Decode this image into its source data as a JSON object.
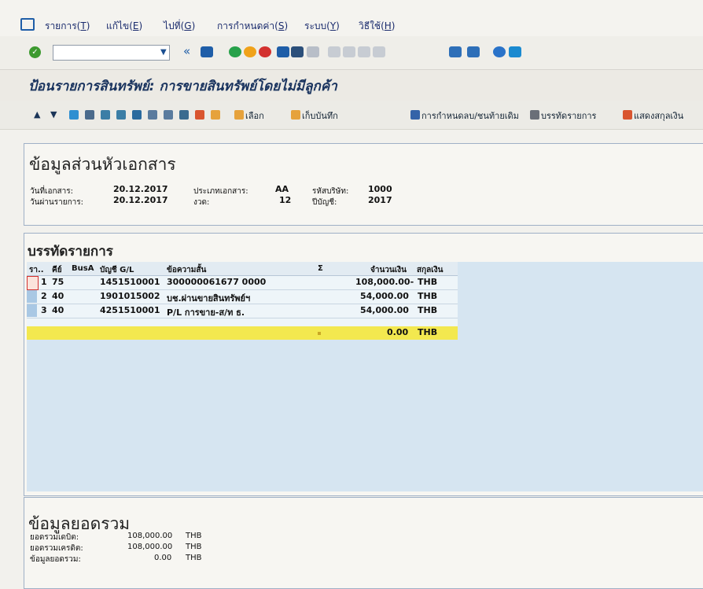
{
  "menu": {
    "items": [
      {
        "label": "รายการ(",
        "key": "T"
      },
      {
        "label": "แก้ไข(",
        "key": "E"
      },
      {
        "label": "ไปที่(",
        "key": "G"
      },
      {
        "label": "การกำหนดค่า(",
        "key": "S"
      },
      {
        "label": "ระบบ(",
        "key": "Y"
      },
      {
        "label": "วิธีใช้(",
        "key": "H"
      }
    ]
  },
  "cmd": {
    "field_value": ""
  },
  "title": "ป้อนรายการสินทรัพย์: การขายสินทรัพย์โดยไม่มีลูกค้า",
  "toolbar": {
    "select": "เลือก",
    "save": "เก็บบันทึก",
    "settings": "การกำหนดลบ/ชนท้ายเดิม",
    "items": "บรรทัดรายการ",
    "currency": "แสดงสกุลเงิน"
  },
  "header": {
    "title": "ข้อมูลส่วนหัวเอกสาร",
    "doc_date_label": "วันที่เอกสาร:",
    "doc_date": "20.12.2017",
    "doc_type_label": "ประเภทเอกสาร:",
    "doc_type": "AA",
    "company_label": "รหัสบริษัท:",
    "company": "1000",
    "post_date_label": "วันผ่านรายการ:",
    "post_date": "20.12.2017",
    "period_label": "งวด:",
    "period": "12",
    "fiscal_label": "ปีบัญชี:",
    "fiscal": "2017"
  },
  "items": {
    "title": "บรรทัดรายการ",
    "columns": [
      "รา..",
      "คีย์",
      "BusA",
      "บัญชี G/L",
      "ข้อความสั้น",
      "Σ",
      "จำนวนเงิน",
      "สกุลเงิน"
    ],
    "rows": [
      {
        "n": "1",
        "key": "75",
        "busa": "",
        "gl": "1451510001",
        "text": "300000061677 0000",
        "amount": "108,000.00-",
        "cur": "THB"
      },
      {
        "n": "2",
        "key": "40",
        "busa": "",
        "gl": "1901015002",
        "text": "บช.ผ่านขายสินทรัพย์ฯ",
        "amount": "54,000.00",
        "cur": "THB"
      },
      {
        "n": "3",
        "key": "40",
        "busa": "",
        "gl": "4251510001",
        "text": "P/L การขาย-ส/ท ธ.",
        "amount": "54,000.00",
        "cur": "THB"
      }
    ],
    "total_amount": "0.00",
    "total_cur": "THB"
  },
  "summary": {
    "title": "ข้อมูลยอดรวม",
    "debit_label": "ยอดรวมเดบิต:",
    "debit": "108,000.00",
    "credit_label": "ยอดรวมเครดิต:",
    "credit": "108,000.00",
    "balance_label": "ข้อมูลยอดรวม:",
    "balance": "0.00",
    "cur": "THB"
  }
}
